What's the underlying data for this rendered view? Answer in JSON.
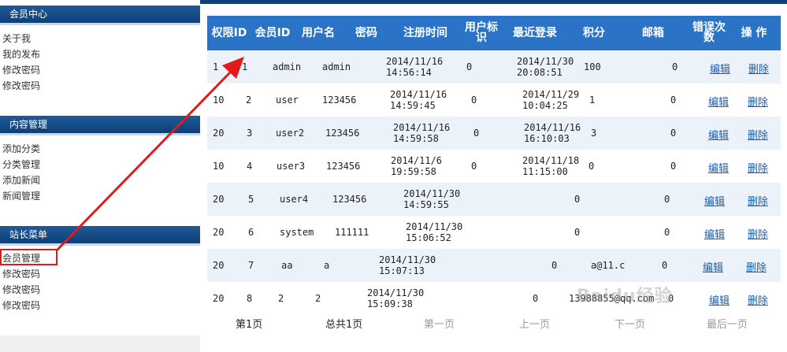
{
  "sidebar": {
    "sections": [
      {
        "title": "会员中心",
        "items": [
          "关于我",
          "我的发布",
          "修改密码",
          "修改密码"
        ]
      },
      {
        "title": "内容管理",
        "items": [
          "添加分类",
          "分类管理",
          "添加新闻",
          "新闻管理"
        ]
      },
      {
        "title": "站长菜单",
        "items": [
          "会员管理",
          "修改密码",
          "修改密码",
          "修改密码"
        ]
      }
    ]
  },
  "table": {
    "headers": [
      "权限ID",
      "会员ID",
      "用户名",
      "密码",
      "注册时间",
      "用户标识",
      "最近登录",
      "积分",
      "邮箱",
      "错误次数",
      "操 作"
    ],
    "edit_label": "编辑",
    "delete_label": "删除",
    "rows": [
      {
        "perm": "1",
        "id": "1",
        "user": "admin",
        "pwd": "admin",
        "reg1": "2014/11/16",
        "reg2": "14:56:14",
        "flag": "0",
        "last1": "2014/11/30",
        "last2": "20:08:51",
        "points": "100",
        "email": "",
        "errors": "0"
      },
      {
        "perm": "10",
        "id": "2",
        "user": "user",
        "pwd": "123456",
        "reg1": "2014/11/16",
        "reg2": "14:59:45",
        "flag": "0",
        "last1": "2014/11/29",
        "last2": "10:04:25",
        "points": "1",
        "email": "",
        "errors": "0"
      },
      {
        "perm": "20",
        "id": "3",
        "user": "user2",
        "pwd": "123456",
        "reg1": "2014/11/16",
        "reg2": "14:59:58",
        "flag": "0",
        "last1": "2014/11/16",
        "last2": "16:10:03",
        "points": "3",
        "email": "",
        "errors": "0"
      },
      {
        "perm": "10",
        "id": "4",
        "user": "user3",
        "pwd": "123456",
        "reg1": "2014/11/6",
        "reg2": "19:59:58",
        "flag": "0",
        "last1": "2014/11/18",
        "last2": "11:15:00",
        "points": "0",
        "email": "",
        "errors": "0"
      },
      {
        "perm": "20",
        "id": "5",
        "user": "user4",
        "pwd": "123456",
        "reg1": "2014/11/30",
        "reg2": "14:59:55",
        "flag": "",
        "last1": "",
        "last2": "",
        "points": "0",
        "email": "",
        "errors": "0"
      },
      {
        "perm": "20",
        "id": "6",
        "user": "system",
        "pwd": "111111",
        "reg1": "2014/11/30",
        "reg2": "15:06:52",
        "flag": "",
        "last1": "",
        "last2": "",
        "points": "0",
        "email": "",
        "errors": "0"
      },
      {
        "perm": "20",
        "id": "7",
        "user": "aa",
        "pwd": "a",
        "reg1": "2014/11/30",
        "reg2": "15:07:13",
        "flag": "",
        "last1": "",
        "last2": "",
        "points": "0",
        "email": "a@11.c",
        "errors": "0"
      },
      {
        "perm": "20",
        "id": "8",
        "user": "2",
        "pwd": "2",
        "reg1": "2014/11/30",
        "reg2": "15:09:38",
        "flag": "",
        "last1": "",
        "last2": "",
        "points": "0",
        "email": "13988855@qq.com",
        "errors": "0"
      }
    ]
  },
  "pager": {
    "current": "第1页",
    "total": "总共1页",
    "first": "第一页",
    "prev": "上一页",
    "next": "下一页",
    "last": "最后一页"
  },
  "watermark": "Baidu经验",
  "colors": {
    "header": "#2a73c7",
    "sidebar_header": "#0e3f77",
    "link": "#1a5fb4",
    "annotation": "#e01b1b"
  }
}
